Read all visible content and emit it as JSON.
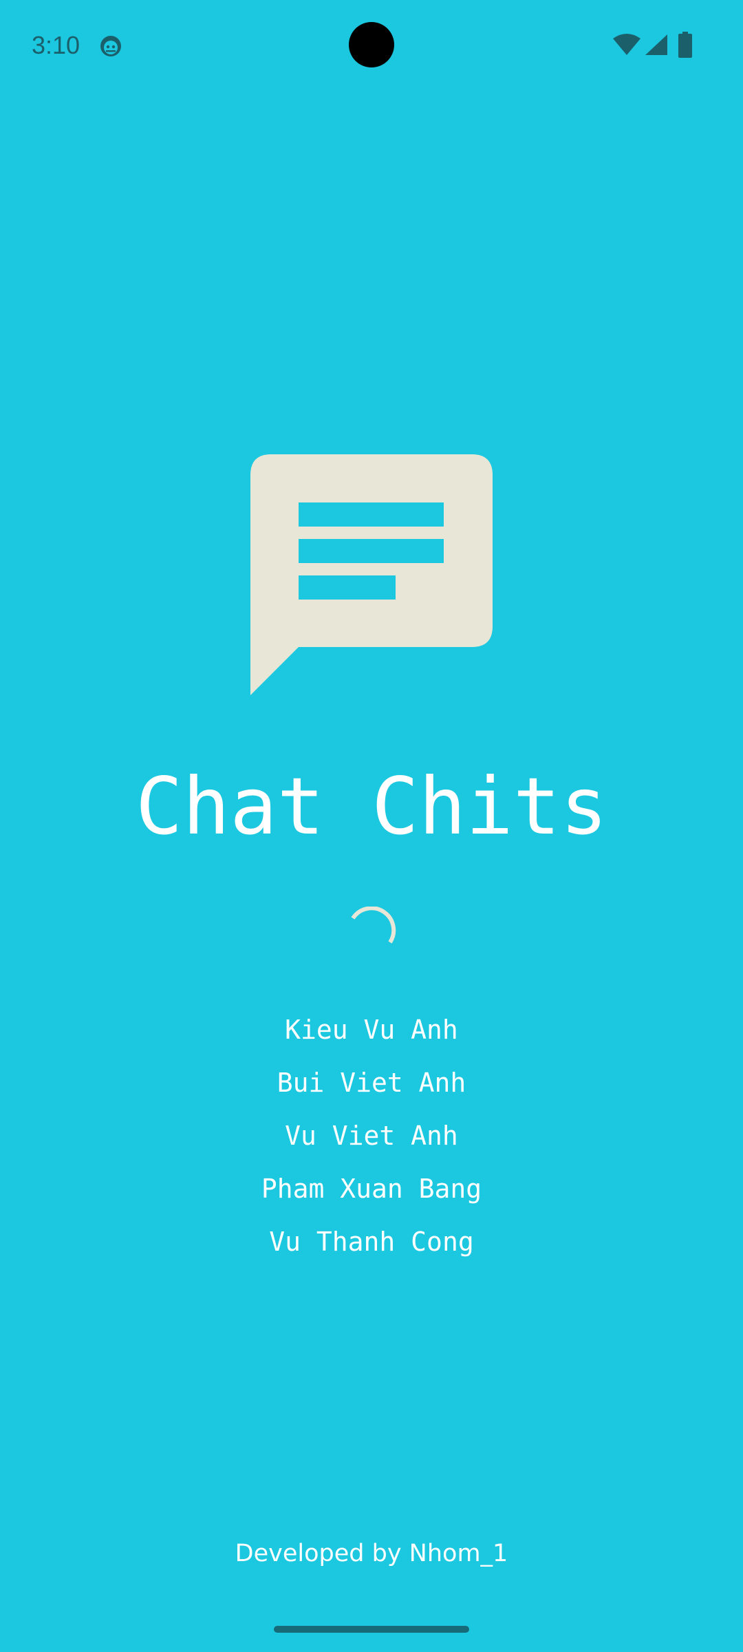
{
  "status_bar": {
    "time": "3:10",
    "icons": [
      "app-notification-icon",
      "wifi-icon",
      "cellular-signal-icon",
      "battery-icon"
    ]
  },
  "logo": {
    "icon": "chat-message-icon"
  },
  "app_title": "Chat Chits",
  "loading": {
    "icon": "loading-spinner-icon"
  },
  "team_members": [
    "Kieu Vu Anh",
    "Bui Viet Anh",
    "Vu Viet Anh",
    "Pham Xuan Bang",
    "Vu Thanh Cong"
  ],
  "footer": "Developed by Nhom_1",
  "colors": {
    "background": "#1cc8e0",
    "logo_bubble": "#e8e6d6",
    "text": "#ffffff",
    "status_icons": "#1b5f6b"
  }
}
